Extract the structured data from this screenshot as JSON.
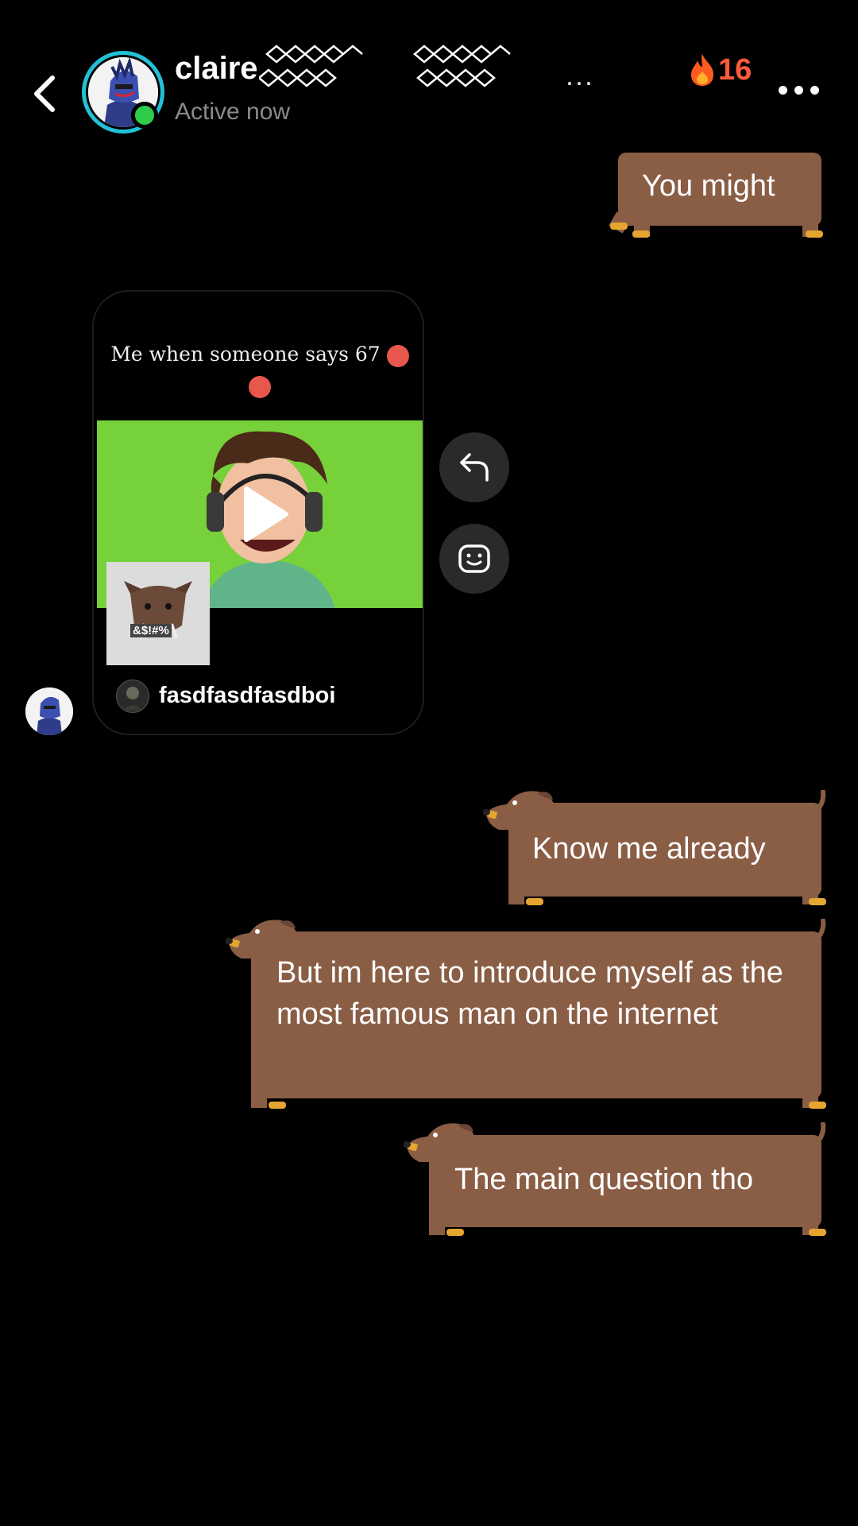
{
  "header": {
    "contact_name": "claire",
    "status": "Active now",
    "name_overflow": "...",
    "streak_count": "16",
    "icons": {
      "back": "chevron-left-icon",
      "streak": "fire-icon",
      "more": "more-horizontal-icon",
      "online": "online-dot"
    }
  },
  "colors": {
    "background": "#000000",
    "bubble": "#8a5d45",
    "streak": "#ff5a3d",
    "online": "#2ecc4a",
    "avatar_ring": "#22c1d6",
    "video_bg": "#77d13a"
  },
  "messages": [
    {
      "text": "You might",
      "from": "me"
    },
    {
      "type": "shared_post",
      "from": "claire",
      "caption": "Me when someone says 67",
      "sticker_text": "&$!#%",
      "author": "fasdfasdfasdboi"
    },
    {
      "text": "Know me already",
      "from": "me"
    },
    {
      "text": "But im here to introduce myself as the most famous man on the internet",
      "from": "me"
    },
    {
      "text": "The main question tho",
      "from": "me"
    }
  ],
  "post_actions": {
    "reply_icon": "reply-icon",
    "react_icon": "emoji-react-icon"
  }
}
